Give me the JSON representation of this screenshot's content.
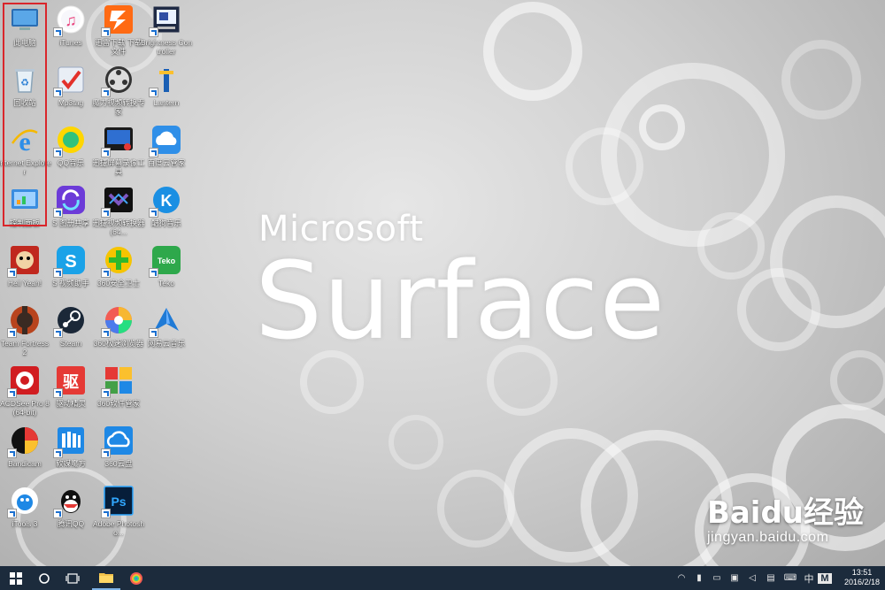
{
  "wallpaper": {
    "brand_top": "Microsoft",
    "brand_main": "Surface"
  },
  "desktop_icons": [
    {
      "name": "此电脑",
      "key": "pc"
    },
    {
      "name": "回收站",
      "key": "recycle"
    },
    {
      "name": "Internet Explorer",
      "key": "ie"
    },
    {
      "name": "控制面板",
      "key": "control"
    },
    {
      "name": "Hell Yeah!",
      "key": "hellyeah"
    },
    {
      "name": "Team Fortress 2",
      "key": "tf2"
    },
    {
      "name": "ACDSee Pro 8 (64-bit)",
      "key": "acdsee"
    },
    {
      "name": "Bandicam",
      "key": "bandicam"
    },
    {
      "name": "iTools 3",
      "key": "itools"
    },
    {
      "name": "iTunes",
      "key": "itunes"
    },
    {
      "name": "Mp3tag",
      "key": "mp3tag"
    },
    {
      "name": "QQ音乐",
      "key": "qqmusic"
    },
    {
      "name": "S 图册共享",
      "key": "s_share"
    },
    {
      "name": "S 视频助手",
      "key": "s_video"
    },
    {
      "name": "Steam",
      "key": "steam"
    },
    {
      "name": "驱动精灵",
      "key": "driver"
    },
    {
      "name": "软媒魔方",
      "key": "ruanmei"
    },
    {
      "name": "腾讯QQ",
      "key": "qq"
    },
    {
      "name": "迅雷下载 下载文件",
      "key": "xunlei"
    },
    {
      "name": "魔力视频转换专家",
      "key": "converter"
    },
    {
      "name": "迅捷屏幕录像工具",
      "key": "recorder"
    },
    {
      "name": "迅捷视频转换器 (64...",
      "key": "convert64"
    },
    {
      "name": "360安全卫士",
      "key": "safe360"
    },
    {
      "name": "360极速浏览器",
      "key": "browser360"
    },
    {
      "name": "360软件管家",
      "key": "softmgr360"
    },
    {
      "name": "360云盘",
      "key": "cloud360"
    },
    {
      "name": "Adobe Photosho...",
      "key": "photoshop"
    },
    {
      "name": "Brightness Controller",
      "key": "brightness"
    },
    {
      "name": "Lantern",
      "key": "lantern"
    },
    {
      "name": "百度云管家",
      "key": "baiduyun"
    },
    {
      "name": "酷狗音乐",
      "key": "kugou"
    },
    {
      "name": "Teko",
      "key": "teko"
    },
    {
      "name": "网易云音乐",
      "key": "netease"
    }
  ],
  "taskbar": {
    "start_icon": "windows-logo-icon",
    "search_icon": "cortana-circle-icon",
    "taskview_icon": "task-view-icon",
    "pinned": [
      "file-explorer-icon",
      "360-browser-icon"
    ],
    "ime_lang": "中",
    "ime_mode": "M",
    "time": "13:51",
    "date": "2016/2/18"
  },
  "watermark": {
    "logo": "Baidu经验",
    "url": "jingyan.baidu.com"
  },
  "colors": {
    "taskbar_bg": "#1c2b3c",
    "selection_border": "#d9262b"
  }
}
